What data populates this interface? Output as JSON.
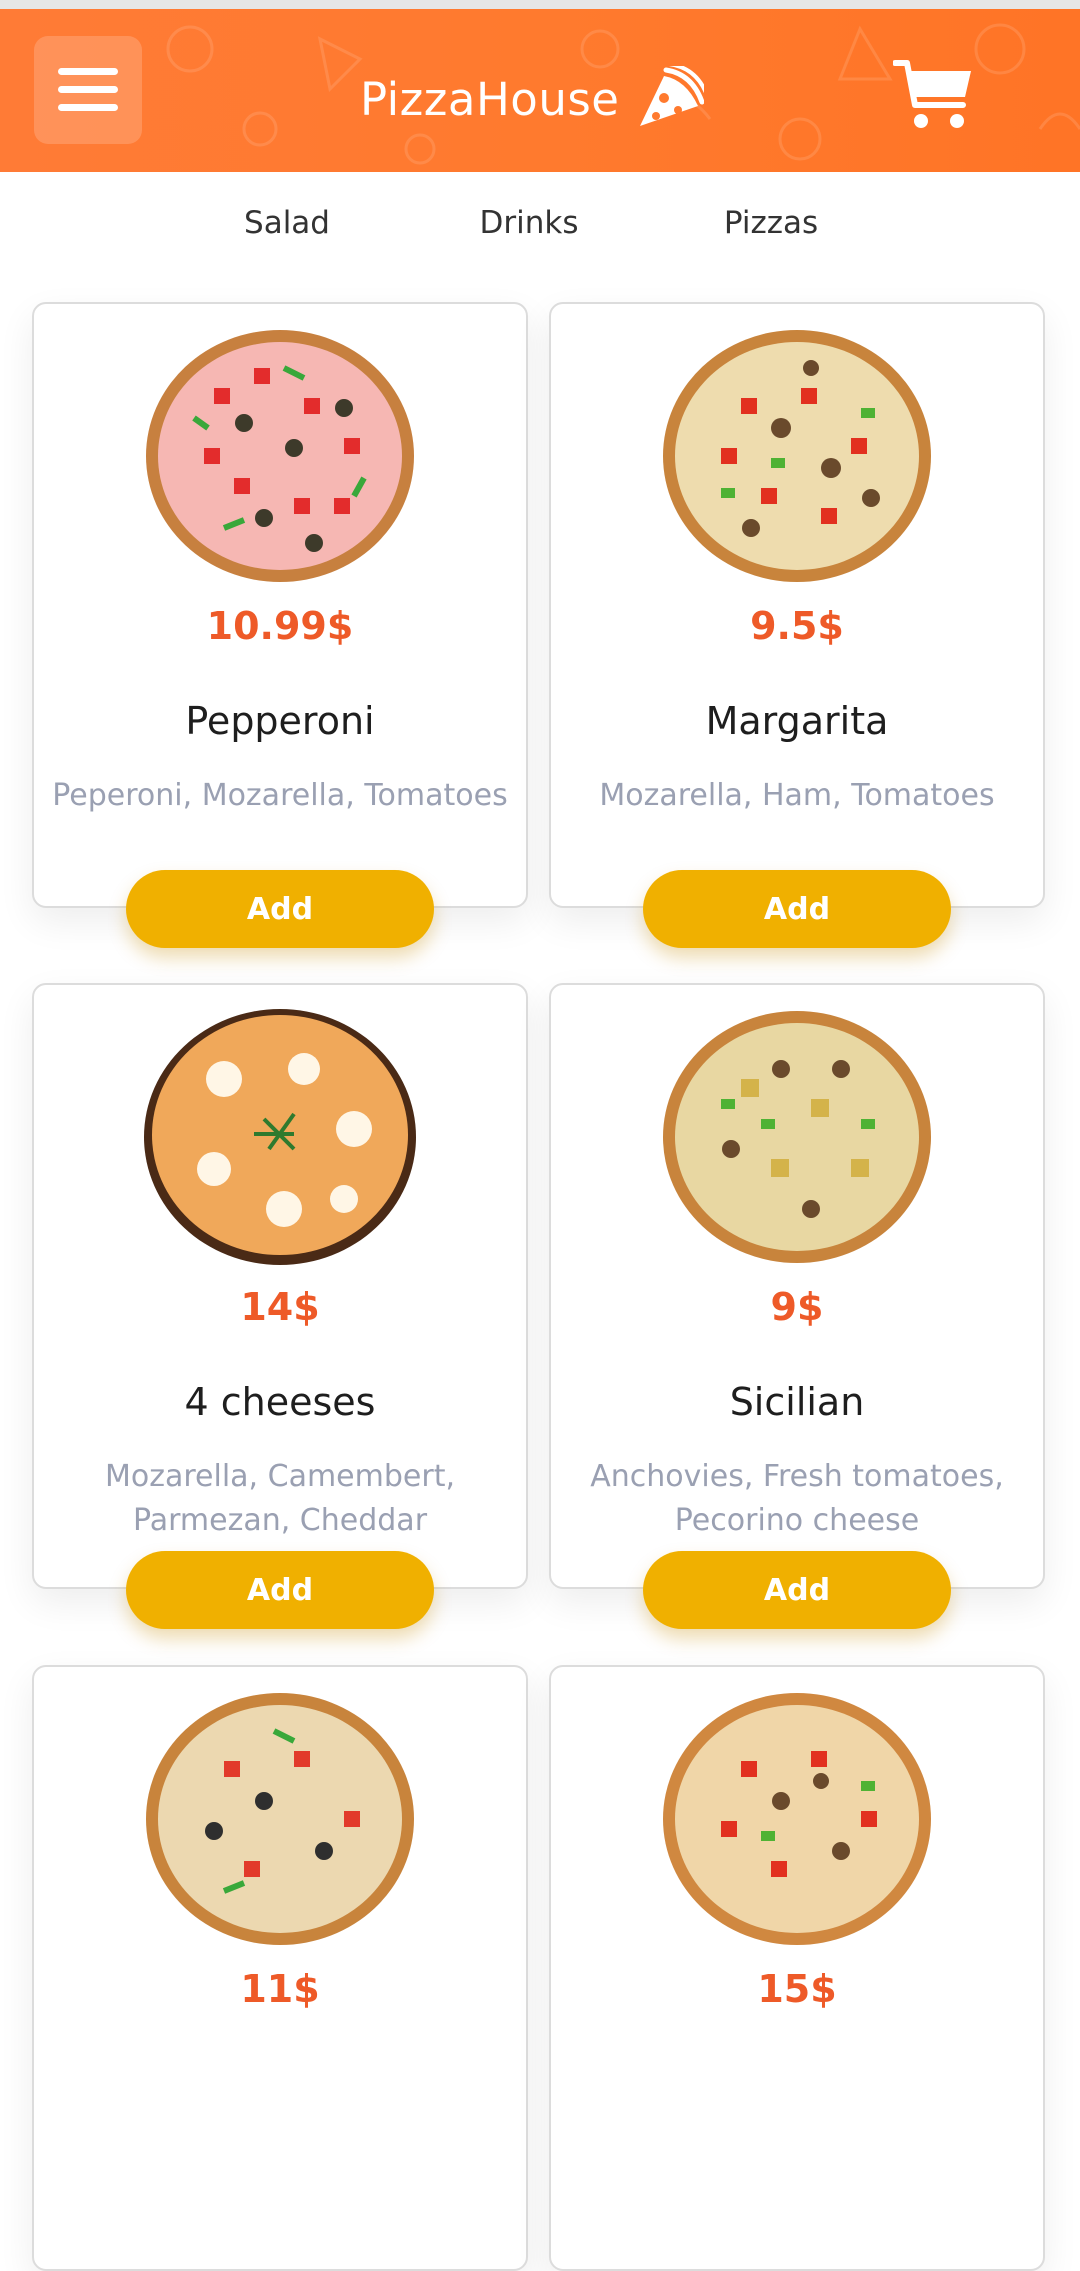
{
  "header": {
    "brand": "PizzaHouse",
    "menu_icon": "hamburger-menu-icon",
    "logo_icon": "pizza-slice-icon",
    "cart_icon": "shopping-cart-icon",
    "color": "#ff7a2e"
  },
  "tabs": [
    "Salad",
    "Drinks",
    "Pizzas"
  ],
  "products": [
    {
      "price": "10.99$",
      "name": "Pepperoni",
      "desc": "Peperoni, Mozarella, Tomatoes",
      "add": "Add"
    },
    {
      "price": "9.5$",
      "name": "Margarita",
      "desc": "Mozarella, Ham, Tomatoes",
      "add": "Add"
    },
    {
      "price": "14$",
      "name": "4 cheeses",
      "desc": "Mozarella, Camembert, Parmezan, Cheddar",
      "add": "Add"
    },
    {
      "price": "9$",
      "name": "Sicilian",
      "desc": "Anchovies, Fresh tomatoes, Pecorino cheese",
      "add": "Add"
    },
    {
      "price": "11$",
      "name": "",
      "desc": "",
      "add": ""
    },
    {
      "price": "15$",
      "name": "",
      "desc": "",
      "add": ""
    }
  ],
  "colors": {
    "accent": "#ee5a28",
    "button": "#f0b000",
    "description": "#9aa0b2"
  }
}
